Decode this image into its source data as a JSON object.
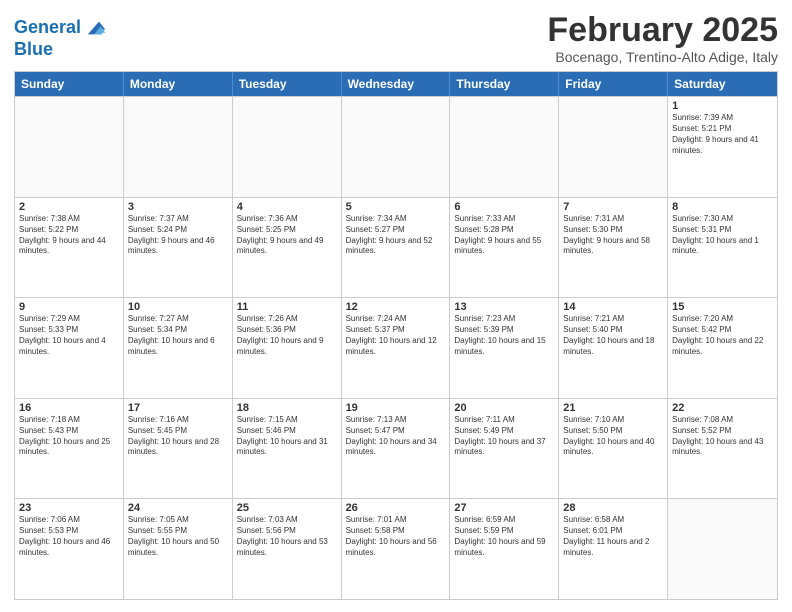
{
  "logo": {
    "line1": "General",
    "line2": "Blue"
  },
  "title": "February 2025",
  "location": "Bocenago, Trentino-Alto Adige, Italy",
  "header": {
    "days": [
      "Sunday",
      "Monday",
      "Tuesday",
      "Wednesday",
      "Thursday",
      "Friday",
      "Saturday"
    ]
  },
  "rows": [
    [
      {
        "day": "",
        "empty": true,
        "text": ""
      },
      {
        "day": "",
        "empty": true,
        "text": ""
      },
      {
        "day": "",
        "empty": true,
        "text": ""
      },
      {
        "day": "",
        "empty": true,
        "text": ""
      },
      {
        "day": "",
        "empty": true,
        "text": ""
      },
      {
        "day": "",
        "empty": true,
        "text": ""
      },
      {
        "day": "1",
        "empty": false,
        "text": "Sunrise: 7:39 AM\nSunset: 5:21 PM\nDaylight: 9 hours and 41 minutes."
      }
    ],
    [
      {
        "day": "2",
        "empty": false,
        "text": "Sunrise: 7:38 AM\nSunset: 5:22 PM\nDaylight: 9 hours and 44 minutes."
      },
      {
        "day": "3",
        "empty": false,
        "text": "Sunrise: 7:37 AM\nSunset: 5:24 PM\nDaylight: 9 hours and 46 minutes."
      },
      {
        "day": "4",
        "empty": false,
        "text": "Sunrise: 7:36 AM\nSunset: 5:25 PM\nDaylight: 9 hours and 49 minutes."
      },
      {
        "day": "5",
        "empty": false,
        "text": "Sunrise: 7:34 AM\nSunset: 5:27 PM\nDaylight: 9 hours and 52 minutes."
      },
      {
        "day": "6",
        "empty": false,
        "text": "Sunrise: 7:33 AM\nSunset: 5:28 PM\nDaylight: 9 hours and 55 minutes."
      },
      {
        "day": "7",
        "empty": false,
        "text": "Sunrise: 7:31 AM\nSunset: 5:30 PM\nDaylight: 9 hours and 58 minutes."
      },
      {
        "day": "8",
        "empty": false,
        "text": "Sunrise: 7:30 AM\nSunset: 5:31 PM\nDaylight: 10 hours and 1 minute."
      }
    ],
    [
      {
        "day": "9",
        "empty": false,
        "text": "Sunrise: 7:29 AM\nSunset: 5:33 PM\nDaylight: 10 hours and 4 minutes."
      },
      {
        "day": "10",
        "empty": false,
        "text": "Sunrise: 7:27 AM\nSunset: 5:34 PM\nDaylight: 10 hours and 6 minutes."
      },
      {
        "day": "11",
        "empty": false,
        "text": "Sunrise: 7:26 AM\nSunset: 5:36 PM\nDaylight: 10 hours and 9 minutes."
      },
      {
        "day": "12",
        "empty": false,
        "text": "Sunrise: 7:24 AM\nSunset: 5:37 PM\nDaylight: 10 hours and 12 minutes."
      },
      {
        "day": "13",
        "empty": false,
        "text": "Sunrise: 7:23 AM\nSunset: 5:39 PM\nDaylight: 10 hours and 15 minutes."
      },
      {
        "day": "14",
        "empty": false,
        "text": "Sunrise: 7:21 AM\nSunset: 5:40 PM\nDaylight: 10 hours and 18 minutes."
      },
      {
        "day": "15",
        "empty": false,
        "text": "Sunrise: 7:20 AM\nSunset: 5:42 PM\nDaylight: 10 hours and 22 minutes."
      }
    ],
    [
      {
        "day": "16",
        "empty": false,
        "text": "Sunrise: 7:18 AM\nSunset: 5:43 PM\nDaylight: 10 hours and 25 minutes."
      },
      {
        "day": "17",
        "empty": false,
        "text": "Sunrise: 7:16 AM\nSunset: 5:45 PM\nDaylight: 10 hours and 28 minutes."
      },
      {
        "day": "18",
        "empty": false,
        "text": "Sunrise: 7:15 AM\nSunset: 5:46 PM\nDaylight: 10 hours and 31 minutes."
      },
      {
        "day": "19",
        "empty": false,
        "text": "Sunrise: 7:13 AM\nSunset: 5:47 PM\nDaylight: 10 hours and 34 minutes."
      },
      {
        "day": "20",
        "empty": false,
        "text": "Sunrise: 7:11 AM\nSunset: 5:49 PM\nDaylight: 10 hours and 37 minutes."
      },
      {
        "day": "21",
        "empty": false,
        "text": "Sunrise: 7:10 AM\nSunset: 5:50 PM\nDaylight: 10 hours and 40 minutes."
      },
      {
        "day": "22",
        "empty": false,
        "text": "Sunrise: 7:08 AM\nSunset: 5:52 PM\nDaylight: 10 hours and 43 minutes."
      }
    ],
    [
      {
        "day": "23",
        "empty": false,
        "text": "Sunrise: 7:06 AM\nSunset: 5:53 PM\nDaylight: 10 hours and 46 minutes."
      },
      {
        "day": "24",
        "empty": false,
        "text": "Sunrise: 7:05 AM\nSunset: 5:55 PM\nDaylight: 10 hours and 50 minutes."
      },
      {
        "day": "25",
        "empty": false,
        "text": "Sunrise: 7:03 AM\nSunset: 5:56 PM\nDaylight: 10 hours and 53 minutes."
      },
      {
        "day": "26",
        "empty": false,
        "text": "Sunrise: 7:01 AM\nSunset: 5:58 PM\nDaylight: 10 hours and 56 minutes."
      },
      {
        "day": "27",
        "empty": false,
        "text": "Sunrise: 6:59 AM\nSunset: 5:59 PM\nDaylight: 10 hours and 59 minutes."
      },
      {
        "day": "28",
        "empty": false,
        "text": "Sunrise: 6:58 AM\nSunset: 6:01 PM\nDaylight: 11 hours and 2 minutes."
      },
      {
        "day": "",
        "empty": true,
        "text": ""
      }
    ]
  ]
}
